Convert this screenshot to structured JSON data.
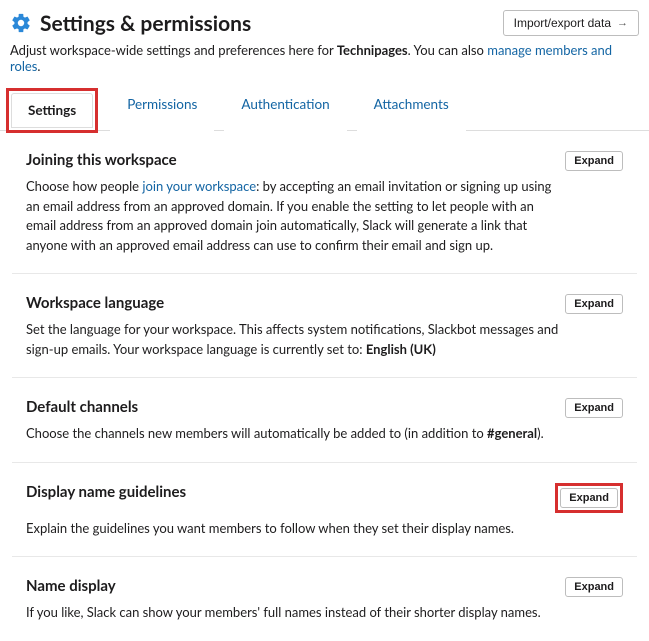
{
  "header": {
    "title": "Settings & permissions",
    "import_label": "Import/export data",
    "subtitle_pre": "Adjust workspace-wide settings and preferences here for ",
    "workspace_name": "Technipages",
    "subtitle_mid": ". You can also ",
    "subtitle_link": "manage members and roles",
    "subtitle_post": "."
  },
  "tabs": {
    "settings": "Settings",
    "permissions": "Permissions",
    "authentication": "Authentication",
    "attachments": "Attachments"
  },
  "expand_label": "Expand",
  "sections": {
    "joining": {
      "title": "Joining this workspace",
      "desc_pre": "Choose how people ",
      "desc_link": "join your workspace",
      "desc_post": ": by accepting an email invitation or signing up using an email address from an approved domain. If you enable the setting to let people with an email address from an approved domain join automatically, Slack will generate a link that anyone with an approved email address can use to confirm their email and sign up."
    },
    "language": {
      "title": "Workspace language",
      "desc_pre": "Set the language for your workspace. This affects system notifications, Slackbot messages and sign-up emails. Your workspace language is currently set to: ",
      "desc_bold": "English (UK)"
    },
    "default_channels": {
      "title": "Default channels",
      "desc_pre": "Choose the channels new members will automatically be added to (in addition to ",
      "desc_bold": "#general",
      "desc_post": ")."
    },
    "display_guidelines": {
      "title": "Display name guidelines",
      "desc": "Explain the guidelines you want members to follow when they set their display names."
    },
    "name_display": {
      "title": "Name display",
      "desc": "If you like, Slack can show your members' full names instead of their shorter display names."
    }
  }
}
